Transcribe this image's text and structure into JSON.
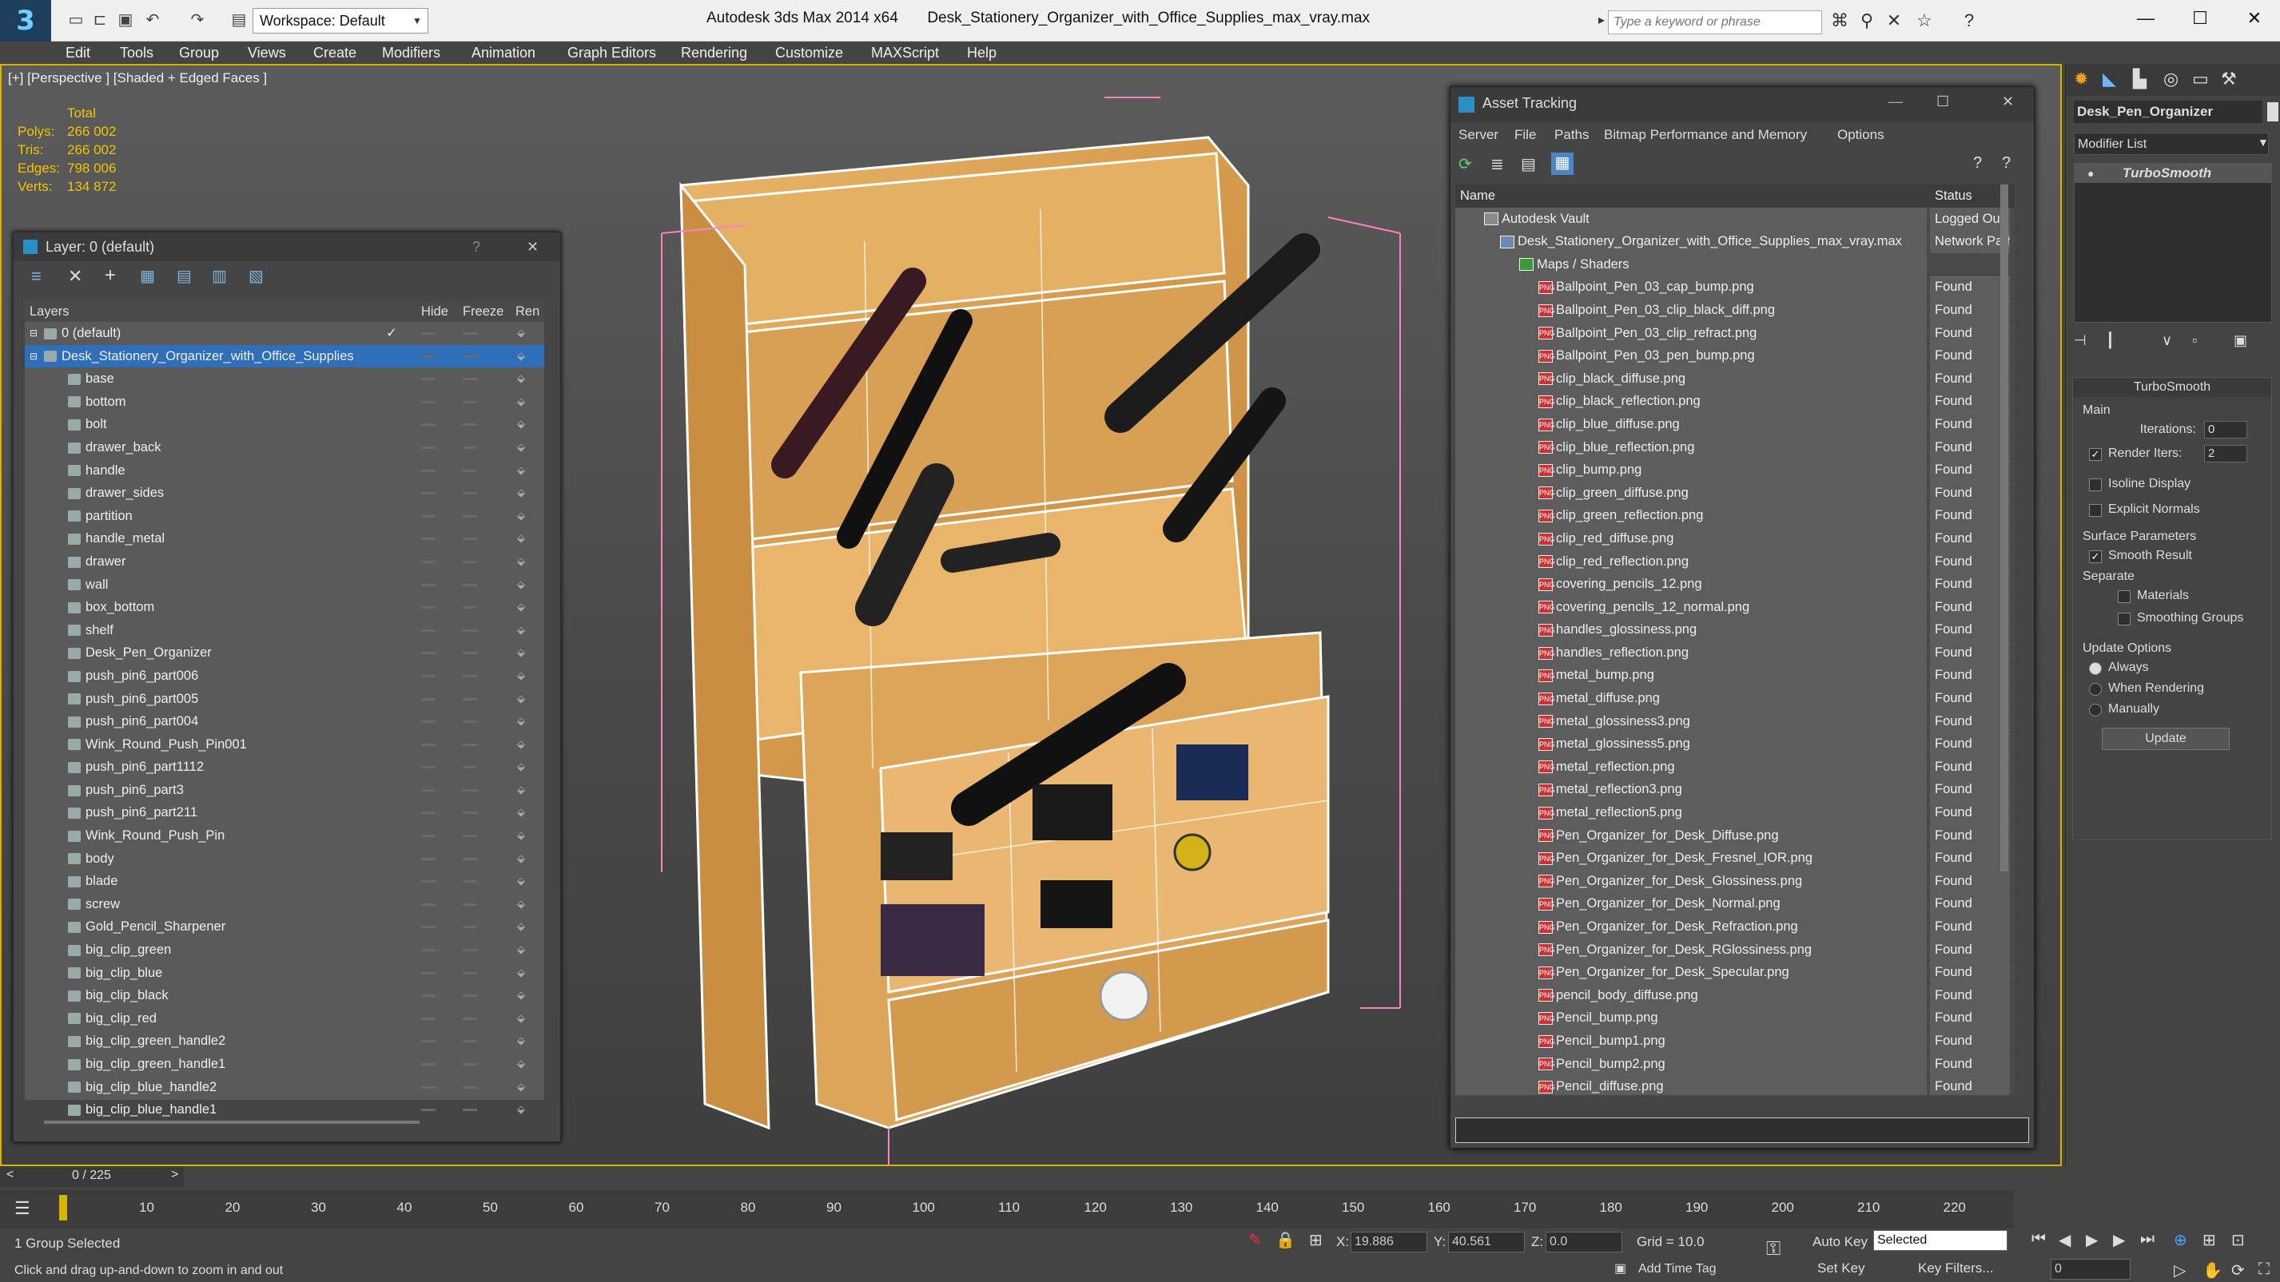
{
  "window": {
    "app_title": "Autodesk 3ds Max  2014 x64",
    "file_title": "Desk_Stationery_Organizer_with_Office_Supplies_max_vray.max",
    "workspace": "Workspace: Default",
    "search_placeholder": "Type a keyword or phrase"
  },
  "menu": [
    "Edit",
    "Tools",
    "Group",
    "Views",
    "Create",
    "Modifiers",
    "Animation",
    "Graph Editors",
    "Rendering",
    "Customize",
    "MAXScript",
    "Help"
  ],
  "viewport": {
    "label": "[+] [Perspective ] [Shaded + Edged Faces ]",
    "stats": {
      "header": "Total",
      "polys_label": "Polys:",
      "polys": "266 002",
      "tris_label": "Tris:",
      "tris": "266 002",
      "edges_label": "Edges:",
      "edges": "798 006",
      "verts_label": "Verts:",
      "verts": "134 872"
    }
  },
  "layer_panel": {
    "title": "Layer: 0 (default)",
    "help": "?",
    "col_layers": "Layers",
    "col_hide": "Hide",
    "col_freeze": "Freeze",
    "col_render": "Ren",
    "rows": [
      "0 (default)",
      "Desk_Stationery_Organizer_with_Office_Supplies",
      "base",
      "bottom",
      "bolt",
      "drawer_back",
      "handle",
      "drawer_sides",
      "partition",
      "handle_metal",
      "drawer",
      "wall",
      "box_bottom",
      "shelf",
      "Desk_Pen_Organizer",
      "push_pin6_part006",
      "push_pin6_part005",
      "push_pin6_part004",
      "Wink_Round_Push_Pin001",
      "push_pin6_part1112",
      "push_pin6_part3",
      "push_pin6_part211",
      "Wink_Round_Push_Pin",
      "body",
      "blade",
      "screw",
      "Gold_Pencil_Sharpener",
      "big_clip_green",
      "big_clip_blue",
      "big_clip_black",
      "big_clip_red",
      "big_clip_green_handle2",
      "big_clip_green_handle1",
      "big_clip_blue_handle2",
      "big_clip_blue_handle1"
    ]
  },
  "asset_tracking": {
    "title": "Asset Tracking",
    "menu": [
      "Server",
      "File",
      "Paths",
      "Bitmap Performance and Memory",
      "Options"
    ],
    "col_name": "Name",
    "col_status": "Status",
    "vault": {
      "name": "Autodesk Vault",
      "status": "Logged Out"
    },
    "file": {
      "name": "Desk_Stationery_Organizer_with_Office_Supplies_max_vray.max",
      "status": "Network Path"
    },
    "maps": "Maps / Shaders",
    "found": "Found",
    "files": [
      "Ballpoint_Pen_03_cap_bump.png",
      "Ballpoint_Pen_03_clip_black_diff.png",
      "Ballpoint_Pen_03_clip_refract.png",
      "Ballpoint_Pen_03_pen_bump.png",
      "clip_black_diffuse.png",
      "clip_black_reflection.png",
      "clip_blue_diffuse.png",
      "clip_blue_reflection.png",
      "clip_bump.png",
      "clip_green_diffuse.png",
      "clip_green_reflection.png",
      "clip_red_diffuse.png",
      "clip_red_reflection.png",
      "covering_pencils_12.png",
      "covering_pencils_12_normal.png",
      "handles_glossiness.png",
      "handles_reflection.png",
      "metal_bump.png",
      "metal_diffuse.png",
      "metal_glossiness3.png",
      "metal_glossiness5.png",
      "metal_reflection.png",
      "metal_reflection3.png",
      "metal_reflection5.png",
      "Pen_Organizer_for_Desk_Diffuse.png",
      "Pen_Organizer_for_Desk_Fresnel_IOR.png",
      "Pen_Organizer_for_Desk_Glossiness.png",
      "Pen_Organizer_for_Desk_Normal.png",
      "Pen_Organizer_for_Desk_Refraction.png",
      "Pen_Organizer_for_Desk_RGlossiness.png",
      "Pen_Organizer_for_Desk_Specular.png",
      "pencil_body_diffuse.png",
      "Pencil_bump.png",
      "Pencil_bump1.png",
      "Pencil_bump2.png",
      "Pencil_diffuse.png"
    ]
  },
  "command_panel": {
    "object_name": "Desk_Pen_Organizer",
    "modifier_list": "Modifier List",
    "modifier": "TurboSmooth",
    "rollout": "TurboSmooth",
    "main": "Main",
    "iterations_label": "Iterations:",
    "iterations": "0",
    "render_iters_label": "Render Iters:",
    "render_iters": "2",
    "isoline": "Isoline Display",
    "explicit_normals": "Explicit Normals",
    "surface_params": "Surface Parameters",
    "smooth_result": "Smooth Result",
    "separate": "Separate",
    "materials": "Materials",
    "smoothing_groups": "Smoothing Groups",
    "update_options": "Update Options",
    "always": "Always",
    "when_rendering": "When Rendering",
    "manually": "Manually",
    "update_btn": "Update"
  },
  "timeline": {
    "frame": "0 / 225",
    "ticks": [
      "10",
      "20",
      "30",
      "40",
      "50",
      "60",
      "70",
      "80",
      "90",
      "100",
      "110",
      "120",
      "130",
      "140",
      "150",
      "160",
      "170",
      "180",
      "190",
      "200",
      "210",
      "220"
    ]
  },
  "status": {
    "selected": "1 Group Selected",
    "prompt": "Click and drag up-and-down to zoom in and out",
    "x_label": "X:",
    "x": "19.886",
    "y_label": "Y:",
    "y": "40.561",
    "z_label": "Z:",
    "z": "0.0",
    "grid": "Grid = 10.0",
    "auto_key": "Auto Key",
    "key_mode": "Selected",
    "set_key": "Set Key",
    "key_filters": "Key Filters...",
    "add_time_tag": "Add Time Tag",
    "frame_field": "0"
  }
}
